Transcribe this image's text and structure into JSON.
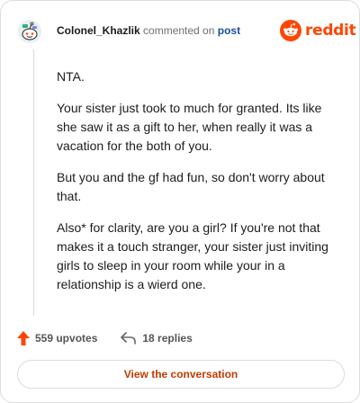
{
  "comment": {
    "username": "Colonel_Khazlik",
    "action_text": "commented on",
    "post_link": "post",
    "paragraphs": [
      "NTA.",
      "Your sister just took to much for granted. Its like she saw it as a gift to her, when really it was a vacation for the both of you.",
      "But you and the gf had fun, so don't worry about that.",
      "Also* for clarity, are you a girl? If you're not that makes it a touch stranger, your sister just inviting girls to sleep in your room while your in a relationship is a wierd one."
    ]
  },
  "brand": {
    "name": "reddit",
    "color": "#ff4500",
    "icon": "reddit-snoo-icon"
  },
  "stats": {
    "upvotes": "559 upvotes",
    "replies": "18 replies"
  },
  "cta": {
    "label": "View the conversation"
  },
  "icons": {
    "avatar": "snoo-avatar-icon",
    "upvote": "upvote-arrow-icon",
    "reply": "reply-arrow-icon"
  },
  "colors": {
    "accent": "#ff4500",
    "link": "#1a4ea0",
    "cta_text": "#c33a00"
  }
}
